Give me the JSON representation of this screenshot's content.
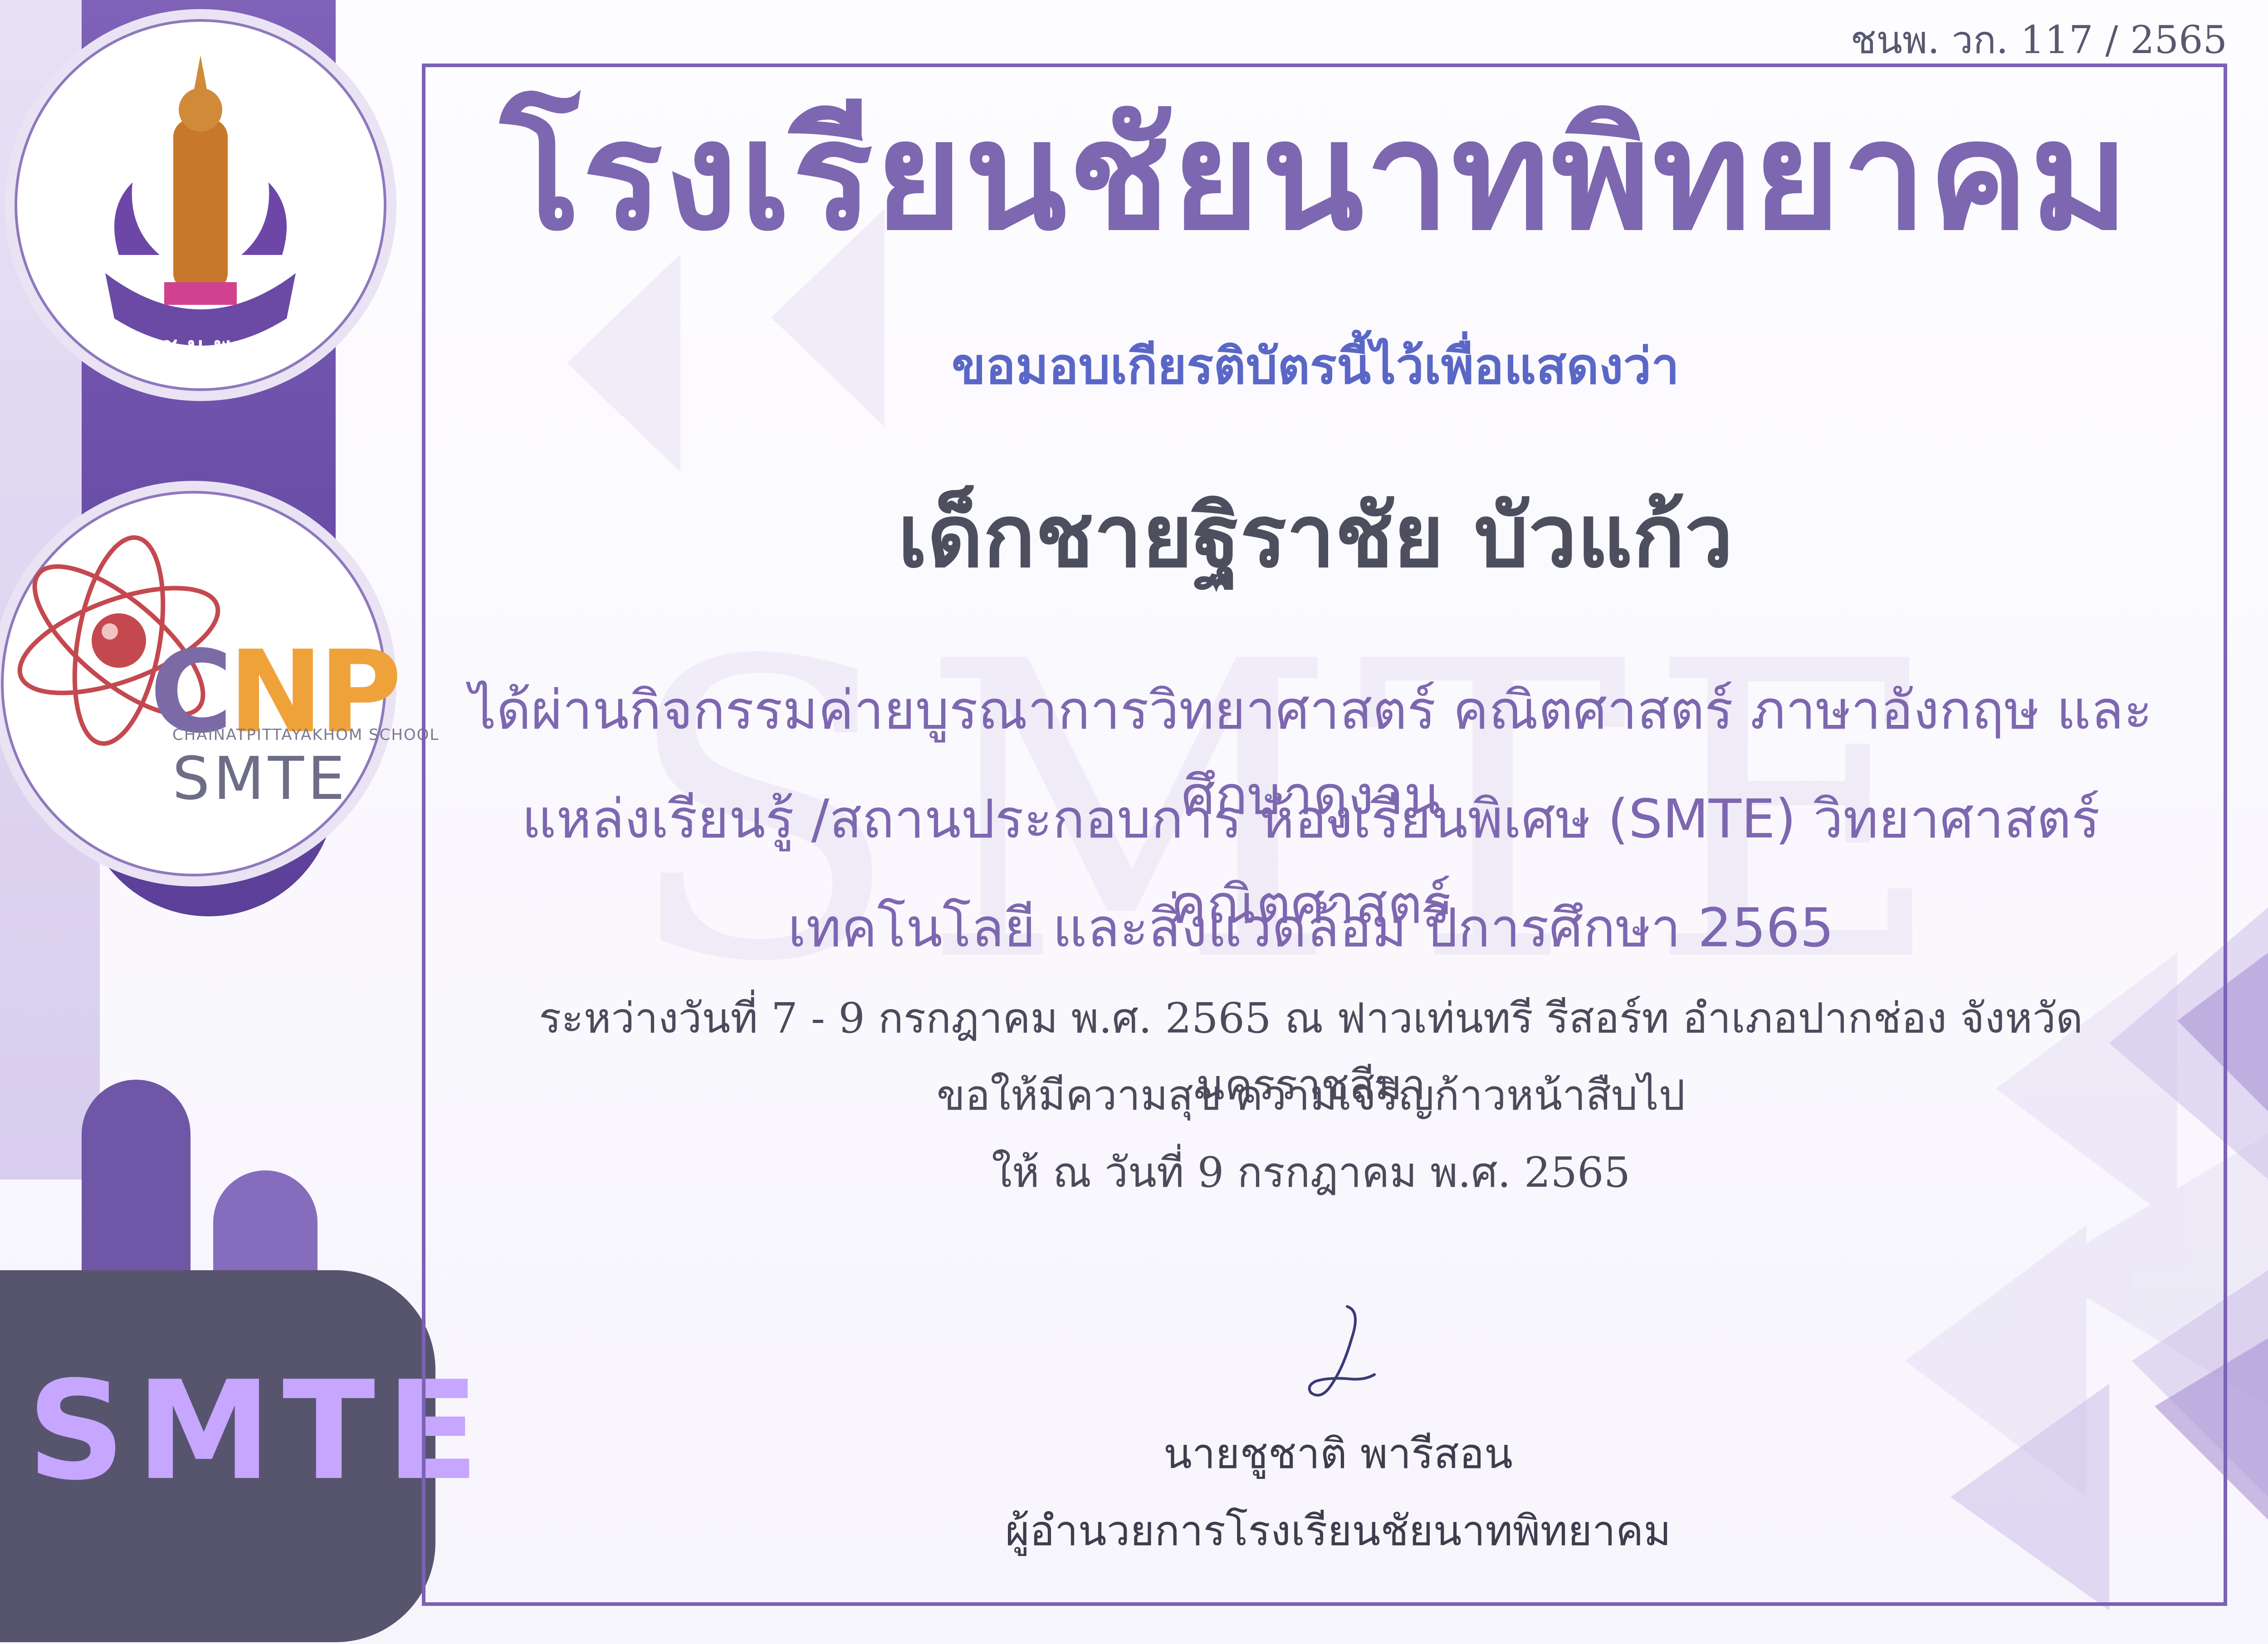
{
  "doc_number": "ชนพ. วก. 117 / 2565",
  "school_name": "โรงเรียนชัยนาทพิทยาคม",
  "subtitle": "ขอมอบเกียรติบัตรนี้ไว้เพื่อแสดงว่า",
  "recipient": "เด็กชายฐิราชัย  บัวแก้ว",
  "watermark": "SMTE",
  "body_lines": [
    "ได้ผ่านกิจกรรมค่ายบูรณาการวิทยาศาสตร์ คณิตศาสตร์ ภาษาอังกฤษ และศึกษาดูงาน",
    "แหล่งเรียนรู้ /สถานประกอบการ ห้องเรียนพิเศษ (SMTE) วิทยาศาสตร์ คณิตศาสตร์",
    "เทคโนโลยี และสิ่งแวดล้อม ปีการศึกษา 2565"
  ],
  "details": [
    "ระหว่างวันที่ 7 - 9 กรกฎาคม พ.ศ. 2565 ณ ฟาวเท่นทรี รีสอร์ท อำเภอปากช่อง จังหวัดนครราชสีมา",
    "ขอให้มีความสุข ความเจริญก้าวหน้าสืบไป",
    "ให้  ณ  วันที่  9  กรกฎาคม  พ.ศ. 2565"
  ],
  "signer_name": "นายชูชาติ  พารีสอน",
  "signer_title": "ผู้อำนวยการโรงเรียนชัยนาทพิทยาคม",
  "logos": {
    "school_emblem_text": "ช.น.พ.",
    "cnp_main_c": "C",
    "cnp_main_np": "NP",
    "cnp_school": "CHAINATPITTAYAKHOM SCHOOL",
    "cnp_program": "SMTE"
  },
  "side_banner": "SMTE",
  "colors": {
    "accent": "#7d67b0",
    "subtitle_blue": "#5a67c7",
    "frame": "#7a62b4",
    "banner_dark": "#57556e"
  }
}
